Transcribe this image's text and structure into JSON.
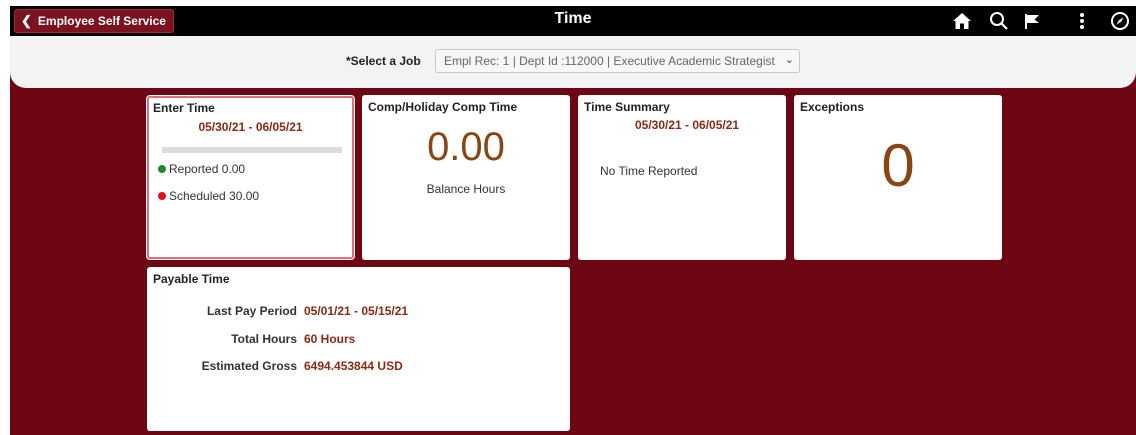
{
  "header": {
    "back_label": "Employee Self Service",
    "title": "Time",
    "icons": [
      "home-icon",
      "search-icon",
      "flag-icon",
      "more-icon",
      "navigator-icon"
    ]
  },
  "job_selector": {
    "label": "*Select a Job",
    "value": "Empl Rec: 1 | Dept Id :112000 | Executive Academic Strategist"
  },
  "tiles": {
    "enter_time": {
      "title": "Enter Time",
      "date_range": "05/30/21 - 06/05/21",
      "progress": 0,
      "reported": "Reported 0.00",
      "scheduled": "Scheduled 30.00"
    },
    "comp_time": {
      "title": "Comp/Holiday Comp Time",
      "value": "0.00",
      "caption": "Balance Hours"
    },
    "time_summary": {
      "title": "Time Summary",
      "date_range": "05/30/21 - 06/05/21",
      "message": "No Time Reported"
    },
    "exceptions": {
      "title": "Exceptions",
      "count": "0"
    },
    "payable_time": {
      "title": "Payable Time",
      "last_pay_period_label": "Last Pay Period",
      "last_pay_period": "05/01/21 - 05/15/21",
      "total_hours_label": "Total Hours",
      "total_hours": "60 Hours",
      "estimated_gross_label": "Estimated Gross",
      "estimated_gross": "6494.453844 USD"
    }
  },
  "colors": {
    "background": "#6e0714",
    "accent_text": "#8b2a14",
    "reported_dot": "#1e8a2e",
    "scheduled_dot": "#e0141e",
    "selected_border": "#e0707a"
  }
}
